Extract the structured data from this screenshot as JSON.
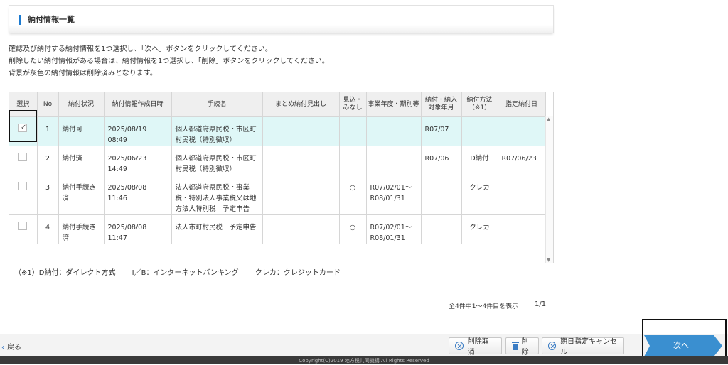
{
  "page": {
    "title": "納付情報一覧",
    "instructions": [
      "確認及び納付する納付情報を1つ選択し、「次へ」ボタンをクリックしてください。",
      "削除したい納付情報がある場合は、納付情報を1つ選択し、「削除」ボタンをクリックしてください。",
      "背景が灰色の納付情報は削除済みとなります。"
    ]
  },
  "table": {
    "headers": {
      "select": "選択",
      "no": "No",
      "status": "納付状況",
      "created": "納付情報作成日時",
      "procedure": "手続名",
      "summary": "まとめ納付見出し",
      "estimate": "見込・みなし",
      "period": "事業年度・期別等",
      "target": "納付・納入対象年月",
      "method": "納付方法（※1）",
      "date": "指定納付日"
    },
    "rows": [
      {
        "checked": "✓",
        "no": "1",
        "status": "納付可",
        "created": "2025/08/19 08:49",
        "procedure": "個人都道府県民税・市区町村民税（特別徴収）",
        "summary": "",
        "estimate": "",
        "period": "",
        "target": "R07/07",
        "method": "",
        "date": ""
      },
      {
        "checked": "",
        "no": "2",
        "status": "納付済",
        "created": "2025/06/23 14:49",
        "procedure": "個人都道府県民税・市区町村民税（特別徴収）",
        "summary": "",
        "estimate": "",
        "period": "",
        "target": "R07/06",
        "method": "D納付",
        "date": "R07/06/23"
      },
      {
        "checked": "",
        "no": "3",
        "status": "納付手続き済",
        "created": "2025/08/08 11:46",
        "procedure": "法人都道府県民税・事業税・特別法人事業税又は地方法人特別税　予定申告",
        "summary": "",
        "estimate": "○",
        "period": "R07/02/01～R08/01/31",
        "target": "",
        "method": "クレカ",
        "date": ""
      },
      {
        "checked": "",
        "no": "4",
        "status": "納付手続き済",
        "created": "2025/08/08 11:47",
        "procedure": "法人市町村民税　予定申告",
        "summary": "",
        "estimate": "○",
        "period": "R07/02/01～R08/01/31",
        "target": "",
        "method": "クレカ",
        "date": ""
      }
    ]
  },
  "legend": {
    "note": "（※1）D納付：ダイレクト方式",
    "ib": "I／B：インターネットバンキング",
    "card": "クレカ：クレジットカード"
  },
  "pagination": {
    "info": "全4件中1～4件目を表示",
    "page": "1/1"
  },
  "footer": {
    "back": "戻る",
    "cancel_delete": "削除取消",
    "delete": "削除",
    "cancel_date": "期日指定キャンセル",
    "next": "次へ"
  },
  "copyright": "Copyright(C)2019 地方税共同機構 All Rights Reserved",
  "colors": {
    "accent": "#1c7ad0",
    "selected_row": "#dff7f7",
    "next_button": "#3a8fd0"
  }
}
